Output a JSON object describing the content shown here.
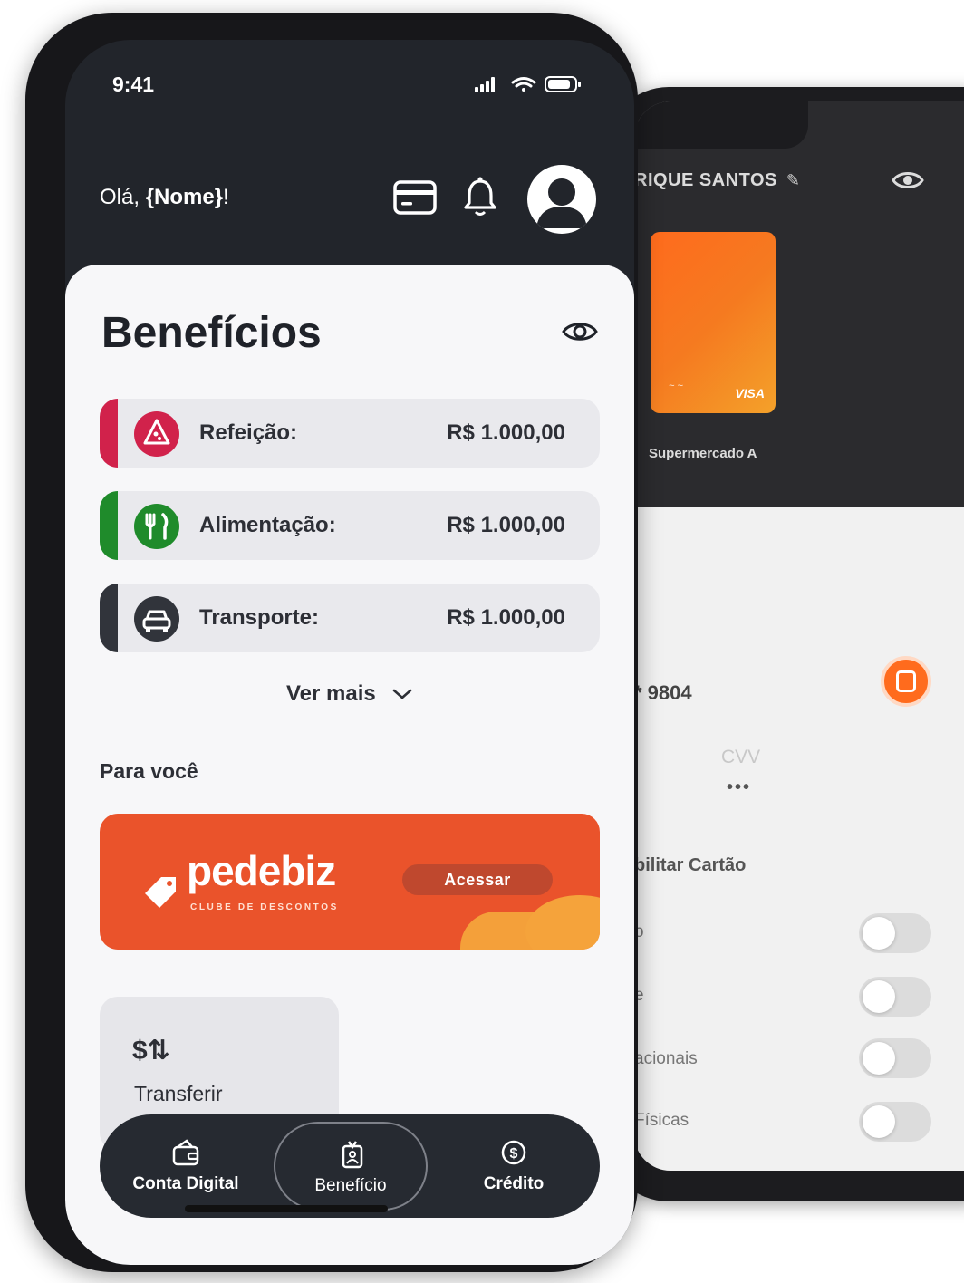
{
  "back_phone": {
    "user_name": "RIQUE SANTOS",
    "edit_icon": "pencil-icon",
    "visibility_icon": "eye-icon",
    "card_brand": "VISA",
    "card_caption": "Supermercado A",
    "card_last4": "* 9804",
    "cvv_label": "CVV",
    "cvv_value": "•••",
    "section_title": "bilitar Cartão",
    "toggle_rows": [
      "o",
      "e",
      "acionais",
      "Físicas"
    ]
  },
  "status_bar": {
    "time": "9:41"
  },
  "header": {
    "greeting_prefix": "Olá, ",
    "greeting_name": "{Nome}",
    "greeting_suffix": "!",
    "card_icon": "credit-card-icon",
    "bell_icon": "bell-icon",
    "avatar_icon": "user-avatar-icon"
  },
  "main": {
    "title": "Benefícios",
    "visibility_icon": "eye-icon",
    "benefits": [
      {
        "label": "Refeição:",
        "value": "R$ 1.000,00",
        "icon": "pizza-icon",
        "color": "#d1224b"
      },
      {
        "label": "Alimentação:",
        "value": "R$ 1.000,00",
        "icon": "fork-knife-icon",
        "color": "#1f8b2b"
      },
      {
        "label": "Transporte:",
        "value": "R$ 1.000,00",
        "icon": "car-icon",
        "color": "#31343b"
      }
    ],
    "see_more": "Ver mais",
    "section_for_you": "Para você",
    "promo": {
      "brand": "pedebiz",
      "subtitle": "CLUBE DE DESCONTOS",
      "button": "Acessar",
      "color": "#ea532b"
    },
    "quick_action": {
      "icon": "$⇅",
      "label": "Transferir"
    }
  },
  "bottom_nav": [
    {
      "label": "Conta Digital",
      "icon": "wallet-icon"
    },
    {
      "label": "Benefício",
      "icon": "badge-icon"
    },
    {
      "label": "Crédito",
      "icon": "dollar-circle-icon"
    }
  ]
}
